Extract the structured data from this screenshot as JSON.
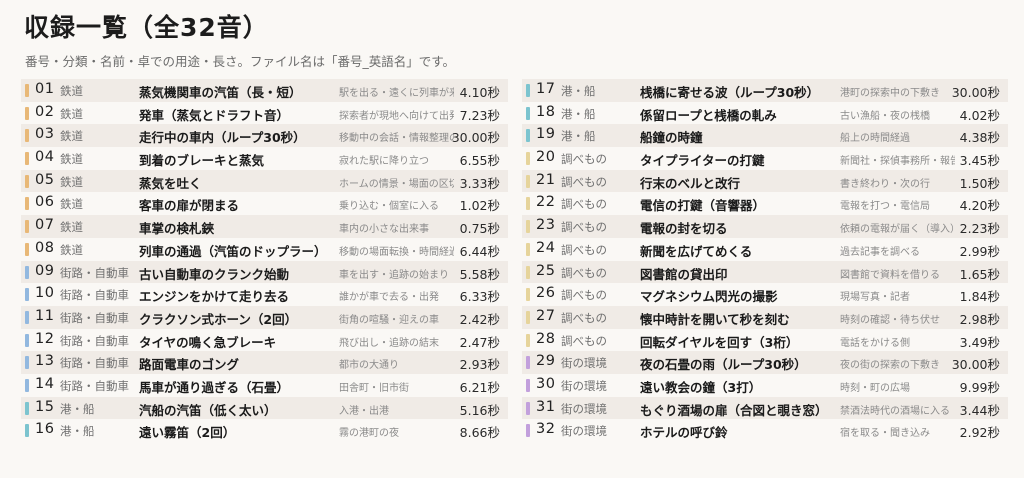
{
  "title": "収録一覧（全32音）",
  "subtitle": "番号・分類・名前・卓での用途・長さ。ファイル名は「番号_英語名」です。",
  "colors": {
    "鉄道": "#e8b877",
    "街路・自動車": "#92b8df",
    "港・船": "#7cc4cf",
    "調べもの": "#e6d49b",
    "街の環境": "#c2a0dc"
  },
  "tracks": [
    {
      "no": "01",
      "category": "鉄道",
      "name": "蒸気機関車の汽笛（長・短）",
      "use": "駅を出る・遠くに列車が来",
      "length": "4.10秒"
    },
    {
      "no": "02",
      "category": "鉄道",
      "name": "発車（蒸気とドラフト音）",
      "use": "探索者が現地へ向けて出発",
      "length": "7.23秒"
    },
    {
      "no": "03",
      "category": "鉄道",
      "name": "走行中の車内（ループ30秒）",
      "use": "移動中の会話・情報整理の",
      "length": "30.00秒"
    },
    {
      "no": "04",
      "category": "鉄道",
      "name": "到着のブレーキと蒸気",
      "use": "寂れた駅に降り立つ",
      "length": "6.55秒"
    },
    {
      "no": "05",
      "category": "鉄道",
      "name": "蒸気を吐く",
      "use": "ホームの情景・場面の区切",
      "length": "3.33秒"
    },
    {
      "no": "06",
      "category": "鉄道",
      "name": "客車の扉が閉まる",
      "use": "乗り込む・個室に入る",
      "length": "1.02秒"
    },
    {
      "no": "07",
      "category": "鉄道",
      "name": "車掌の検札鋏",
      "use": "車内の小さな出来事",
      "length": "0.75秒"
    },
    {
      "no": "08",
      "category": "鉄道",
      "name": "列車の通過（汽笛のドップラー）",
      "use": "移動の場面転換・時間経過",
      "length": "6.44秒"
    },
    {
      "no": "09",
      "category": "街路・自動車",
      "name": "古い自動車のクランク始動",
      "use": "車を出す・追跡の始まり",
      "length": "5.58秒"
    },
    {
      "no": "10",
      "category": "街路・自動車",
      "name": "エンジンをかけて走り去る",
      "use": "誰かが車で去る・出発",
      "length": "6.33秒"
    },
    {
      "no": "11",
      "category": "街路・自動車",
      "name": "クラクソン式ホーン（2回）",
      "use": "街角の喧騒・迎えの車",
      "length": "2.42秒"
    },
    {
      "no": "12",
      "category": "街路・自動車",
      "name": "タイヤの鳴く急ブレーキ",
      "use": "飛び出し・追跡の結末",
      "length": "2.47秒"
    },
    {
      "no": "13",
      "category": "街路・自動車",
      "name": "路面電車のゴング",
      "use": "都市の大通り",
      "length": "2.93秒"
    },
    {
      "no": "14",
      "category": "街路・自動車",
      "name": "馬車が通り過ぎる（石畳）",
      "use": "田舎町・旧市街",
      "length": "6.21秒"
    },
    {
      "no": "15",
      "category": "港・船",
      "name": "汽船の汽笛（低く太い）",
      "use": "入港・出港",
      "length": "5.16秒"
    },
    {
      "no": "16",
      "category": "港・船",
      "name": "遠い霧笛（2回）",
      "use": "霧の港町の夜",
      "length": "8.66秒"
    },
    {
      "no": "17",
      "category": "港・船",
      "name": "桟橋に寄せる波（ループ30秒）",
      "use": "港町の探索中の下敷き",
      "length": "30.00秒"
    },
    {
      "no": "18",
      "category": "港・船",
      "name": "係留ロープと桟橋の軋み",
      "use": "古い漁船・夜の桟橋",
      "length": "4.02秒"
    },
    {
      "no": "19",
      "category": "港・船",
      "name": "船鐘の時鐘",
      "use": "船上の時間経過",
      "length": "4.38秒"
    },
    {
      "no": "20",
      "category": "調べもの",
      "name": "タイプライターの打鍵",
      "use": "新聞社・探偵事務所・報告",
      "length": "3.45秒"
    },
    {
      "no": "21",
      "category": "調べもの",
      "name": "行末のベルと改行",
      "use": "書き終わり・次の行",
      "length": "1.50秒"
    },
    {
      "no": "22",
      "category": "調べもの",
      "name": "電信の打鍵（音響器）",
      "use": "電報を打つ・電信局",
      "length": "4.20秒"
    },
    {
      "no": "23",
      "category": "調べもの",
      "name": "電報の封を切る",
      "use": "依頼の電報が届く（導入）",
      "length": "2.23秒"
    },
    {
      "no": "24",
      "category": "調べもの",
      "name": "新聞を広げてめくる",
      "use": "過去記事を調べる",
      "length": "2.99秒"
    },
    {
      "no": "25",
      "category": "調べもの",
      "name": "図書館の貸出印",
      "use": "図書館で資料を借りる",
      "length": "1.65秒"
    },
    {
      "no": "26",
      "category": "調べもの",
      "name": "マグネシウム閃光の撮影",
      "use": "現場写真・記者",
      "length": "1.84秒"
    },
    {
      "no": "27",
      "category": "調べもの",
      "name": "懐中時計を開いて秒を刻む",
      "use": "時刻の確認・待ち伏せ",
      "length": "2.98秒"
    },
    {
      "no": "28",
      "category": "調べもの",
      "name": "回転ダイヤルを回す（3桁）",
      "use": "電話をかける側",
      "length": "3.49秒"
    },
    {
      "no": "29",
      "category": "街の環境",
      "name": "夜の石畳の雨（ループ30秒）",
      "use": "夜の街の探索の下敷き",
      "length": "30.00秒"
    },
    {
      "no": "30",
      "category": "街の環境",
      "name": "遠い教会の鐘（3打）",
      "use": "時刻・町の広場",
      "length": "9.99秒"
    },
    {
      "no": "31",
      "category": "街の環境",
      "name": "もぐり酒場の扉（合図と覗き窓）",
      "use": "禁酒法時代の酒場に入る",
      "length": "3.44秒"
    },
    {
      "no": "32",
      "category": "街の環境",
      "name": "ホテルの呼び鈴",
      "use": "宿を取る・聞き込み",
      "length": "2.92秒"
    }
  ]
}
